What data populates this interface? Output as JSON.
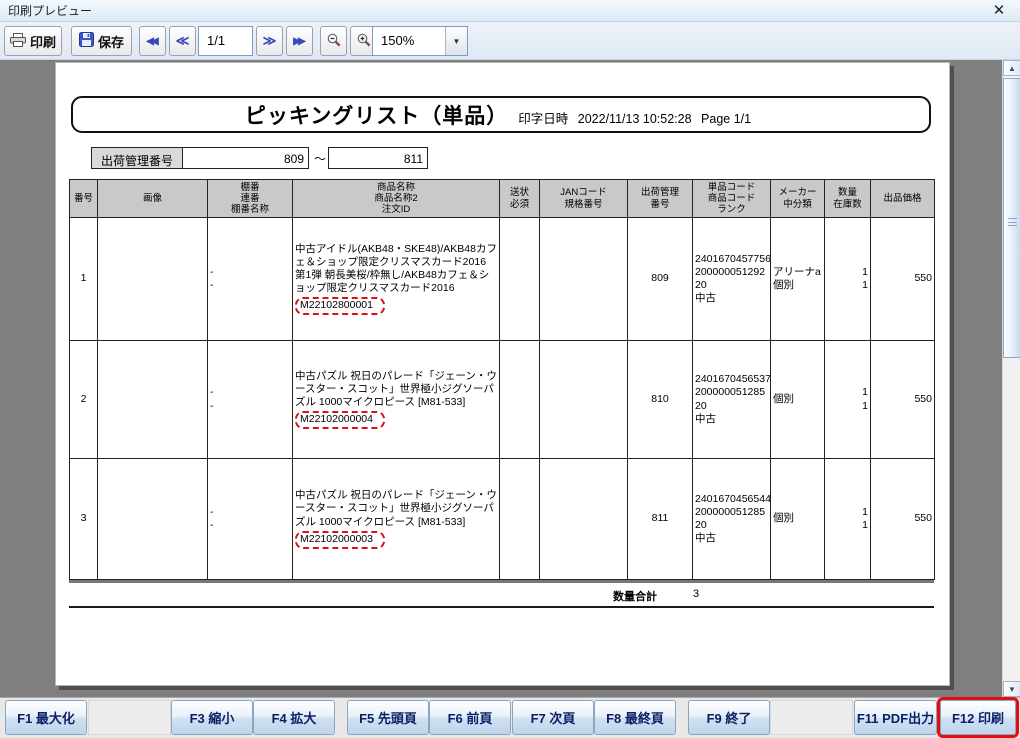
{
  "window": {
    "title": "印刷プレビュー"
  },
  "icons": {
    "close": "✕",
    "first_page": "◀◀",
    "prev_page": "≪",
    "next_page": "≫",
    "last_page": "▶▶",
    "combo_arrow": "▼",
    "scroll_up": "▲",
    "scroll_down": "▼"
  },
  "toolbar": {
    "print_label": "印刷",
    "save_label": "保存",
    "page_value": "1/1",
    "zoom_value": "150%"
  },
  "document": {
    "title": "ピッキングリスト（単品）",
    "printed_at_label": "印字日時",
    "printed_at": "2022/11/13 10:52:28",
    "page_label": "Page 1/1",
    "range_label": "出荷管理番号",
    "range_from": "809",
    "range_separator": "～",
    "range_to": "811",
    "table": {
      "headers": [
        "番号",
        "画像",
        "棚番\n連番\n棚番名称",
        "商品名称\n商品名称2\n注文ID",
        "送状\n必須",
        "JANコード\n規格番号",
        "出荷管理\n番号",
        "単品コード\n商品コード\nランク",
        "メーカー\n中分類",
        "数量\n在庫数",
        "出品価格"
      ],
      "rows": [
        {
          "no": "1",
          "image": "",
          "shelf": "-\n-",
          "product": "中古アイドル(AKB48・SKE48)/AKB48カフェ＆ショップ限定クリスマスカード2016　第1弾 朝長美桜/枠無し/AKB48カフェ＆ショップ限定クリスマスカード2016",
          "order_id": "M22102800001",
          "invoice": "",
          "jan": "",
          "ship_no": "809",
          "codes": "2401670457756\n200000051292\n20\n中古",
          "maker": "アリーナa\n個別",
          "qty": "1\n1",
          "price": "550"
        },
        {
          "no": "2",
          "image": "",
          "shelf": "-\n-",
          "product": "中古パズル 祝日のパレード「ジェーン・ウースター・スコット」世界極小ジグソーパズル 1000マイクロピース [M81-533]",
          "order_id": "M22102000004",
          "invoice": "",
          "jan": "",
          "ship_no": "810",
          "codes": "2401670456537\n200000051285\n20\n中古",
          "maker": "個別",
          "qty": "1\n1",
          "price": "550"
        },
        {
          "no": "3",
          "image": "",
          "shelf": "-\n-",
          "product": "中古パズル 祝日のパレード「ジェーン・ウースター・スコット」世界極小ジグソーパズル 1000マイクロピース [M81-533]",
          "order_id": "M22102000003",
          "invoice": "",
          "jan": "",
          "ship_no": "811",
          "codes": "2401670456544\n200000051285\n20\n中古",
          "maker": "個別",
          "qty": "1\n1",
          "price": "550"
        }
      ],
      "total_label": "数量合計",
      "total_value": "3"
    }
  },
  "fkeys": {
    "f1": "F1 最大化",
    "f3": "F3 縮小",
    "f4": "F4 拡大",
    "f5": "F5 先頭頁",
    "f6": "F6 前頁",
    "f7": "F7 次頁",
    "f8": "F8 最終頁",
    "f9": "F9 終了",
    "f11": "F11 PDF出力",
    "f12": "F12 印刷"
  },
  "colors": {
    "highlight_red": "#e01010",
    "header_grey": "#c9c9c9",
    "preview_background": "#7f7f7f"
  }
}
